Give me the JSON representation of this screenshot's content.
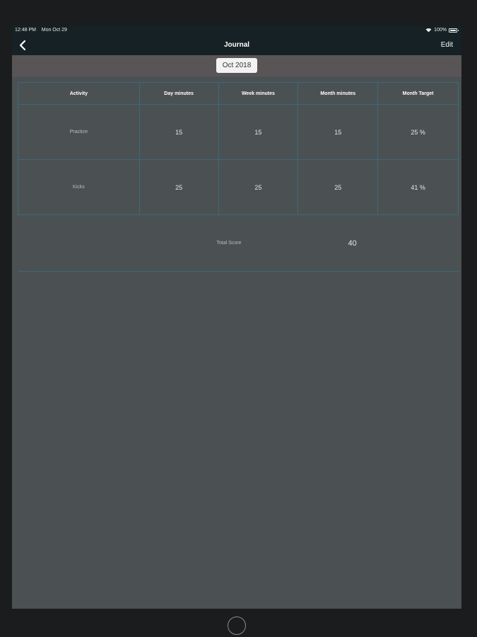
{
  "status_bar": {
    "time": "12:48 PM",
    "date": "Mon Oct 29",
    "battery": "100%"
  },
  "nav": {
    "title": "Journal",
    "edit_label": "Edit"
  },
  "month_picker": {
    "value": "Oct 2018"
  },
  "table": {
    "headers": [
      "Activity",
      "Day minutes",
      "Week minutes",
      "Month minutes",
      "Month Target"
    ],
    "rows": [
      {
        "activity": "Practice",
        "day": "15",
        "week": "15",
        "month": "15",
        "target": "25 %"
      },
      {
        "activity": "Kicks",
        "day": "25",
        "week": "25",
        "month": "25",
        "target": "41 %"
      }
    ],
    "total_label": "Total Score",
    "total_value": "40"
  },
  "colors": {
    "background": "#4b5153",
    "nav": "#152125",
    "grid": "#3a6a78"
  }
}
